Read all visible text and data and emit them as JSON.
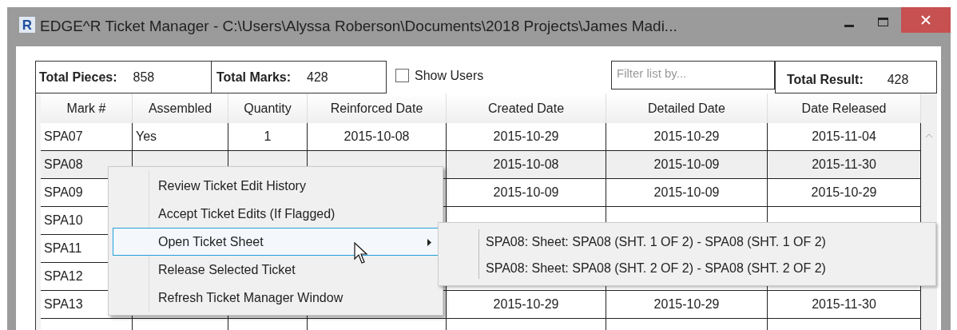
{
  "window": {
    "icon_letter": "R",
    "title": "EDGE^R Ticket Manager - C:\\Users\\Alyssa Roberson\\Documents\\2018 Projects\\James Madi..."
  },
  "summary": {
    "total_pieces_label": "Total Pieces:",
    "total_pieces": "858",
    "total_marks_label": "Total Marks:",
    "total_marks": "428",
    "show_users": {
      "label": "Show Users",
      "checked": false
    },
    "filter": {
      "placeholder": "Filter list by..."
    },
    "total_result_label": "Total Result:",
    "total_result": "428"
  },
  "table": {
    "columns": [
      "Mark #",
      "Assembled",
      "Quantity",
      "Reinforced Date",
      "Created Date",
      "Detailed Date",
      "Date Released"
    ],
    "rows": [
      {
        "selected": false,
        "cells": [
          "SPA07",
          "Yes",
          "1",
          "2015-10-08",
          "2015-10-29",
          "2015-10-29",
          "2015-11-04"
        ]
      },
      {
        "selected": true,
        "cells": [
          "SPA08",
          null,
          null,
          null,
          "2015-10-08",
          "2015-10-09",
          "2015-11-30"
        ]
      },
      {
        "selected": false,
        "cells": [
          "SPA09",
          null,
          null,
          null,
          "2015-10-09",
          "2015-10-09",
          "2015-10-29"
        ]
      },
      {
        "selected": false,
        "cells": [
          "SPA10",
          null,
          null,
          null,
          null,
          null,
          null
        ]
      },
      {
        "selected": false,
        "cells": [
          "SPA11",
          null,
          null,
          null,
          null,
          null,
          null
        ]
      },
      {
        "selected": false,
        "cells": [
          "SPA12",
          null,
          null,
          null,
          null,
          null,
          null
        ]
      },
      {
        "selected": false,
        "cells": [
          "SPA13",
          null,
          null,
          null,
          "2015-10-29",
          "2015-10-29",
          "2015-11-30"
        ]
      },
      {
        "selected": false,
        "cells": [
          null,
          null,
          null,
          null,
          null,
          null,
          null
        ]
      }
    ]
  },
  "context_menu": {
    "items": [
      {
        "label": "Review Ticket Edit History",
        "selected": false,
        "submenu": false
      },
      {
        "label": "Accept Ticket Edits (If Flagged)",
        "selected": false,
        "submenu": false
      },
      {
        "label": "Open Ticket Sheet",
        "selected": true,
        "submenu": true
      },
      {
        "label": "Release Selected Ticket",
        "selected": false,
        "submenu": false
      },
      {
        "label": "Refresh Ticket Manager Window",
        "selected": false,
        "submenu": false
      }
    ]
  },
  "submenu": {
    "items": [
      {
        "label": "SPA08: Sheet: SPA08 (SHT. 1 OF 2) - SPA08 (SHT. 1 OF 2)"
      },
      {
        "label": "SPA08: Sheet: SPA08 (SHT. 2 OF 2) - SPA08 (SHT. 2 OF 2)"
      }
    ]
  }
}
